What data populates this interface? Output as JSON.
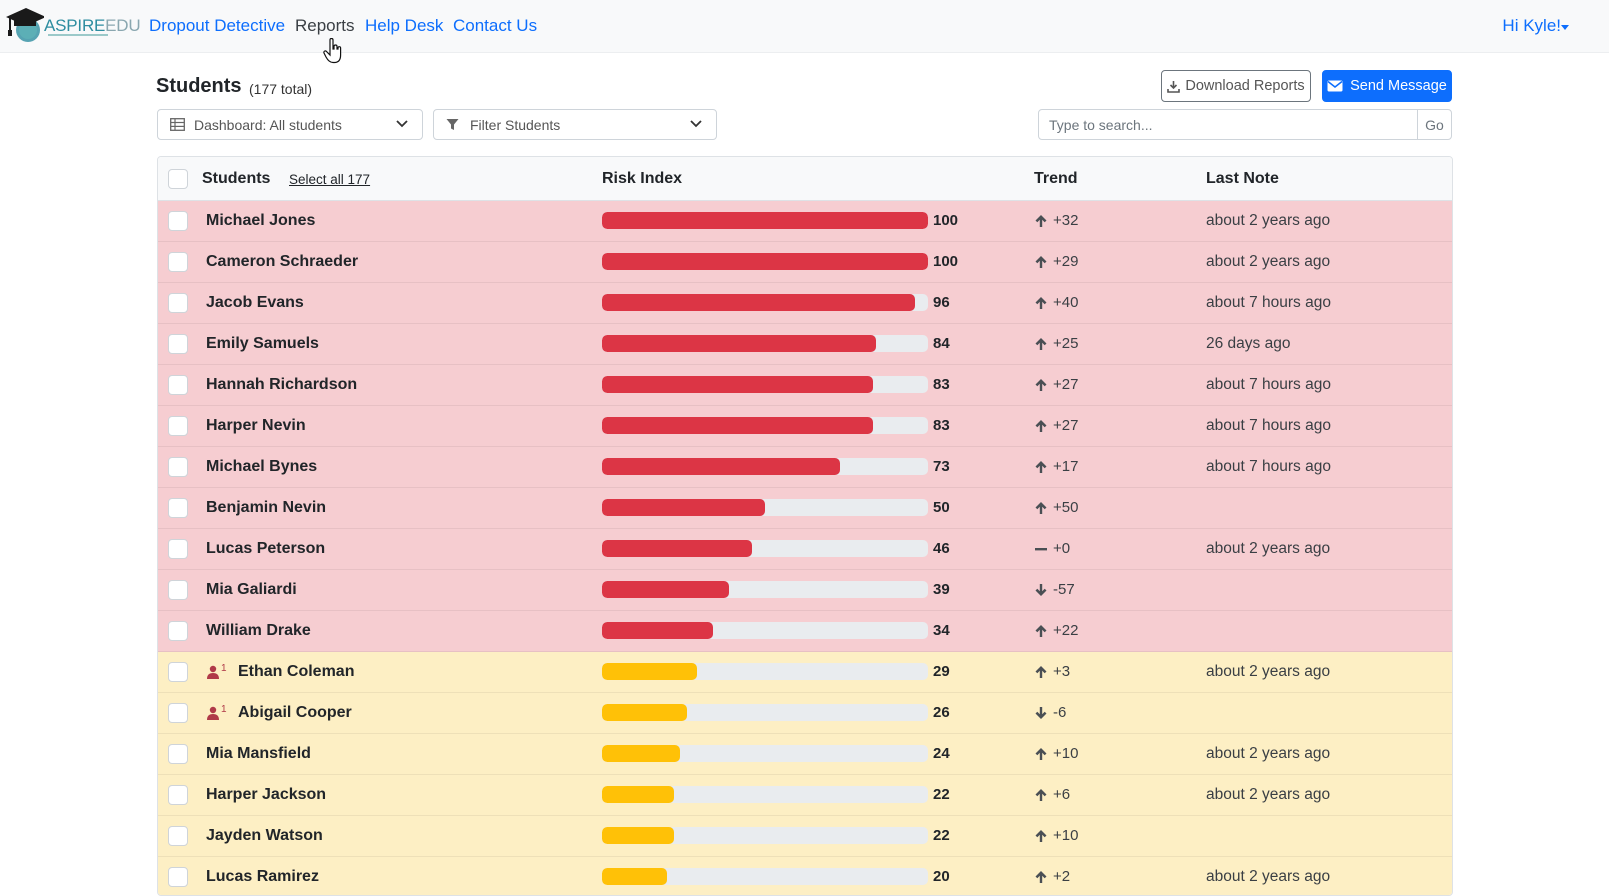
{
  "colors": {
    "high": "#dc3545",
    "mid": "#ffc107",
    "track": "#e9ecef",
    "accent": "#0d6efd"
  },
  "nav": {
    "logo_aspire": "ASPIRE",
    "logo_edu": "EDU",
    "links": [
      {
        "label": "Dropout Detective",
        "dark": false
      },
      {
        "label": "Reports",
        "dark": true
      },
      {
        "label": "Help Desk",
        "dark": false
      },
      {
        "label": "Contact Us",
        "dark": false
      }
    ],
    "user": "Hi Kyle!"
  },
  "header": {
    "title": "Students",
    "total": "(177 total)",
    "download_label": "Download Reports",
    "send_label": "Send Message"
  },
  "filters": {
    "dashboard": "Dashboard: All students",
    "filter": "Filter Students",
    "search_placeholder": "Type to search...",
    "go_label": "Go"
  },
  "table": {
    "headers": {
      "students": "Students",
      "select_all": "Select all 177",
      "risk": "Risk Index",
      "trend": "Trend",
      "note": "Last Note"
    },
    "rows": [
      {
        "name": "Michael Jones",
        "risk": 100,
        "level": "high",
        "dir": "up",
        "trend": "+32",
        "note": "about 2 years ago",
        "flag": ""
      },
      {
        "name": "Cameron Schraeder",
        "risk": 100,
        "level": "high",
        "dir": "up",
        "trend": "+29",
        "note": "about 2 years ago",
        "flag": ""
      },
      {
        "name": "Jacob Evans",
        "risk": 96,
        "level": "high",
        "dir": "up",
        "trend": "+40",
        "note": "about 7 hours ago",
        "flag": ""
      },
      {
        "name": "Emily Samuels",
        "risk": 84,
        "level": "high",
        "dir": "up",
        "trend": "+25",
        "note": "26 days ago",
        "flag": ""
      },
      {
        "name": "Hannah Richardson",
        "risk": 83,
        "level": "high",
        "dir": "up",
        "trend": "+27",
        "note": "about 7 hours ago",
        "flag": ""
      },
      {
        "name": "Harper Nevin",
        "risk": 83,
        "level": "high",
        "dir": "up",
        "trend": "+27",
        "note": "about 7 hours ago",
        "flag": ""
      },
      {
        "name": "Michael Bynes",
        "risk": 73,
        "level": "high",
        "dir": "up",
        "trend": "+17",
        "note": "about 7 hours ago",
        "flag": ""
      },
      {
        "name": "Benjamin Nevin",
        "risk": 50,
        "level": "high",
        "dir": "up",
        "trend": "+50",
        "note": "",
        "flag": ""
      },
      {
        "name": "Lucas Peterson",
        "risk": 46,
        "level": "high",
        "dir": "flat",
        "trend": "+0",
        "note": "about 2 years ago",
        "flag": ""
      },
      {
        "name": "Mia Galiardi",
        "risk": 39,
        "level": "high",
        "dir": "down",
        "trend": "-57",
        "note": "",
        "flag": ""
      },
      {
        "name": "William Drake",
        "risk": 34,
        "level": "high",
        "dir": "up",
        "trend": "+22",
        "note": "",
        "flag": ""
      },
      {
        "name": "Ethan Coleman",
        "risk": 29,
        "level": "mid",
        "dir": "up",
        "trend": "+3",
        "note": "about 2 years ago",
        "flag": "1"
      },
      {
        "name": "Abigail Cooper",
        "risk": 26,
        "level": "mid",
        "dir": "down",
        "trend": "-6",
        "note": "",
        "flag": "1"
      },
      {
        "name": "Mia Mansfield",
        "risk": 24,
        "level": "mid",
        "dir": "up",
        "trend": "+10",
        "note": "about 2 years ago",
        "flag": ""
      },
      {
        "name": "Harper Jackson",
        "risk": 22,
        "level": "mid",
        "dir": "up",
        "trend": "+6",
        "note": "about 2 years ago",
        "flag": ""
      },
      {
        "name": "Jayden Watson",
        "risk": 22,
        "level": "mid",
        "dir": "up",
        "trend": "+10",
        "note": "",
        "flag": ""
      },
      {
        "name": "Lucas Ramirez",
        "risk": 20,
        "level": "mid",
        "dir": "up",
        "trend": "+2",
        "note": "about 2 years ago",
        "flag": ""
      }
    ]
  }
}
